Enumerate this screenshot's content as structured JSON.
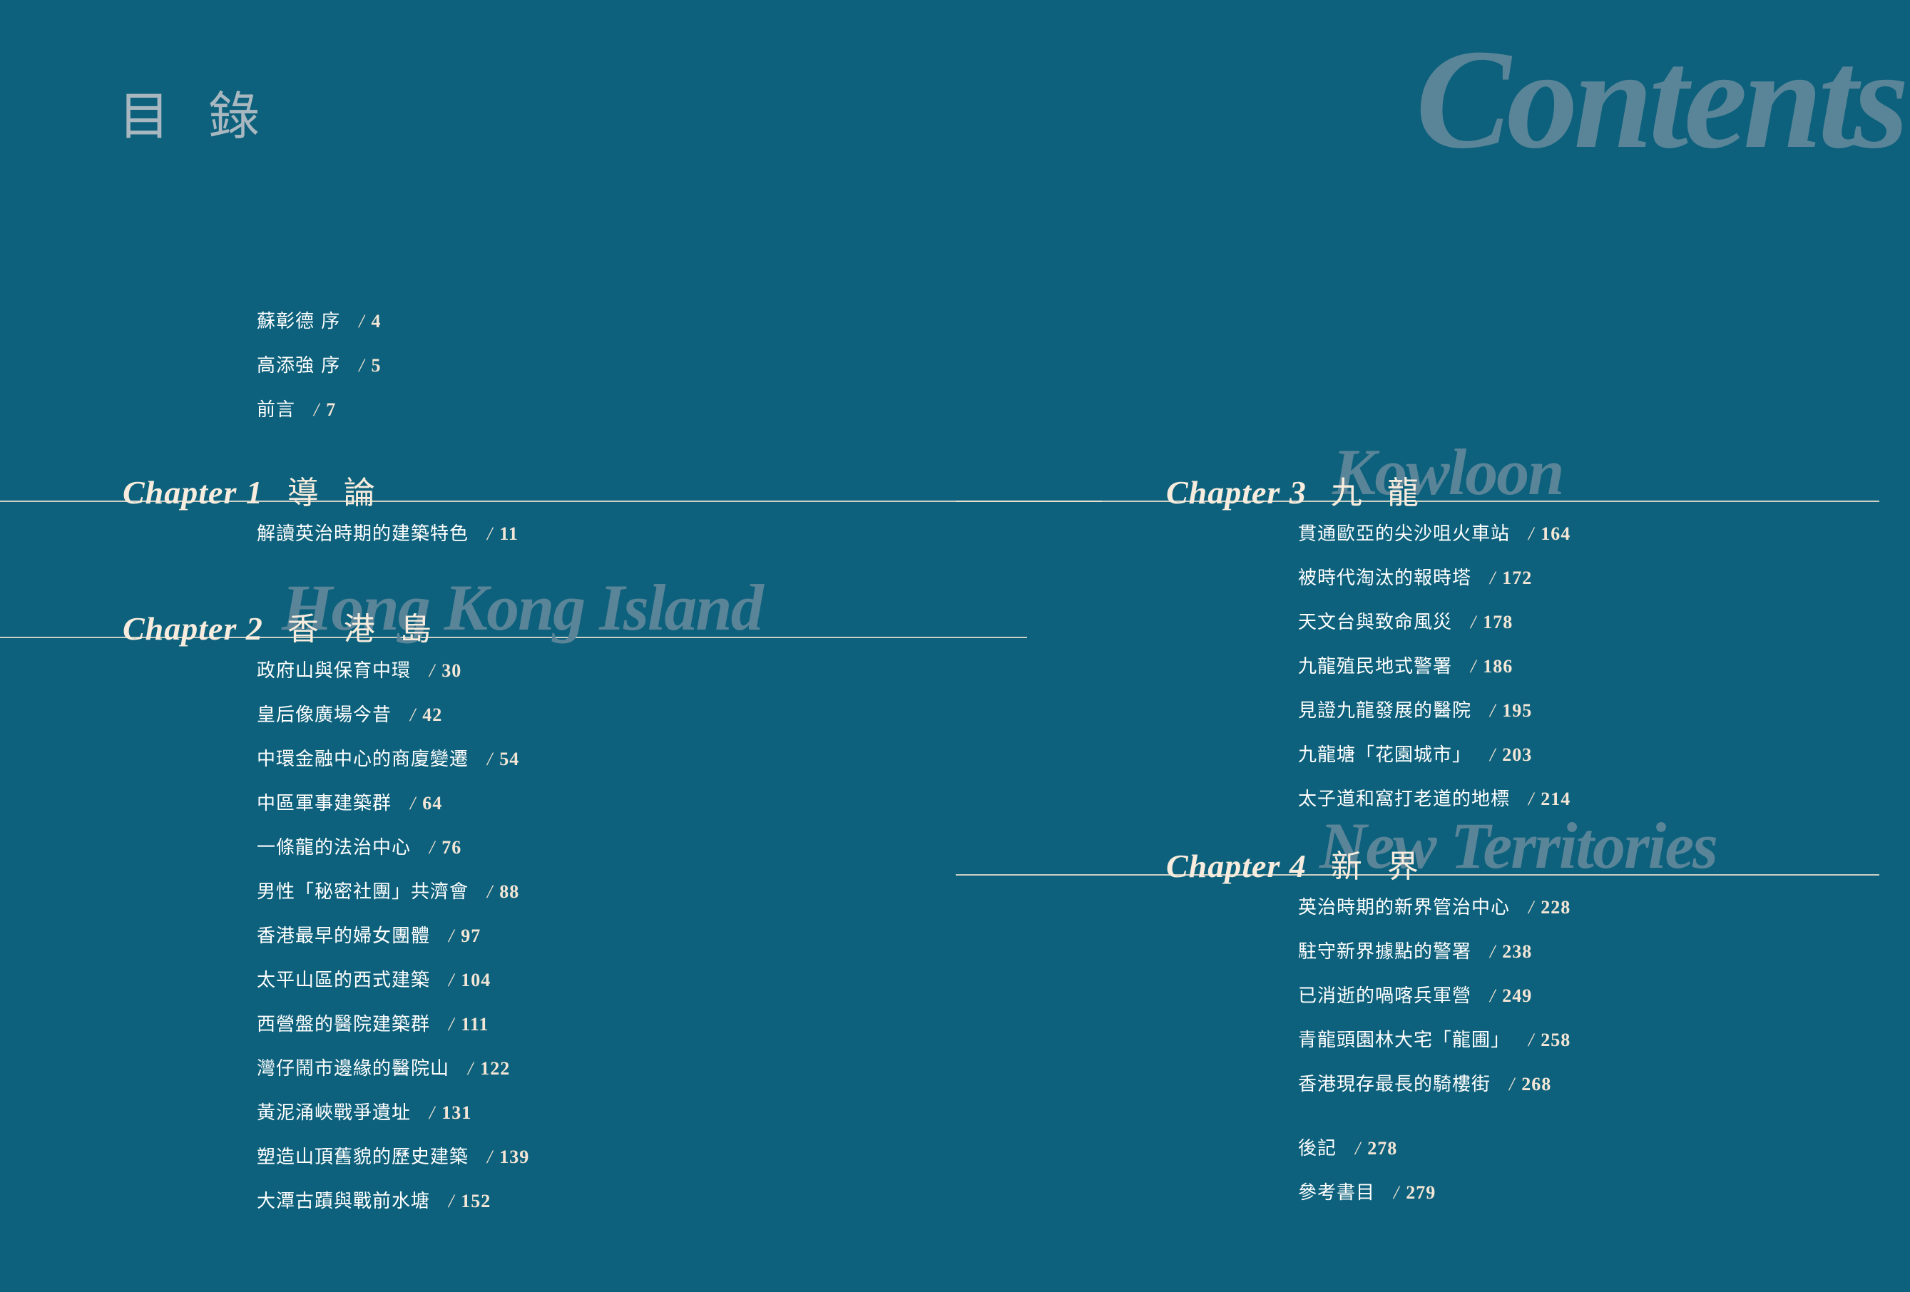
{
  "masthead": {
    "title_cn": "目 錄",
    "title_en": "Contents"
  },
  "colors": {
    "background": "#0d617c",
    "cream": "#f4e6d6",
    "white": "#ffffff",
    "watermark": "#5a8599",
    "masthead_cn": "#a9b8c0"
  },
  "separator": "/",
  "frontmatter": [
    {
      "title": "蘇彰德 序",
      "page": "4"
    },
    {
      "title": "高添強 序",
      "page": "5"
    },
    {
      "title": "前言",
      "page": "7"
    }
  ],
  "chapters": [
    {
      "number": "Chapter 1",
      "title_cn": "導 論",
      "watermark": "",
      "entries": [
        {
          "title": "解讀英治時期的建築特色",
          "page": "11"
        }
      ]
    },
    {
      "number": "Chapter 2",
      "title_cn": "香 港 島",
      "watermark": "Hong Kong Island",
      "entries": [
        {
          "title": "政府山與保育中環",
          "page": "30"
        },
        {
          "title": "皇后像廣場今昔",
          "page": "42"
        },
        {
          "title": "中環金融中心的商廈變遷",
          "page": "54"
        },
        {
          "title": "中區軍事建築群",
          "page": "64"
        },
        {
          "title": "一條龍的法治中心",
          "page": "76"
        },
        {
          "title": "男性「秘密社團」共濟會",
          "page": "88"
        },
        {
          "title": "香港最早的婦女團體",
          "page": "97"
        },
        {
          "title": "太平山區的西式建築",
          "page": "104"
        },
        {
          "title": "西營盤的醫院建築群",
          "page": "111"
        },
        {
          "title": "灣仔鬧市邊緣的醫院山",
          "page": "122"
        },
        {
          "title": "黃泥涌峽戰爭遺址",
          "page": "131"
        },
        {
          "title": "塑造山頂舊貌的歷史建築",
          "page": "139"
        },
        {
          "title": "大潭古蹟與戰前水塘",
          "page": "152"
        }
      ]
    },
    {
      "number": "Chapter 3",
      "title_cn": "九 龍",
      "watermark": "Kowloon",
      "entries": [
        {
          "title": "貫通歐亞的尖沙咀火車站",
          "page": "164"
        },
        {
          "title": "被時代淘汰的報時塔",
          "page": "172"
        },
        {
          "title": "天文台與致命風災",
          "page": "178"
        },
        {
          "title": "九龍殖民地式警署",
          "page": "186"
        },
        {
          "title": "見證九龍發展的醫院",
          "page": "195"
        },
        {
          "title": "九龍塘「花園城市」",
          "page": "203"
        },
        {
          "title": "太子道和窩打老道的地標",
          "page": "214"
        }
      ]
    },
    {
      "number": "Chapter 4",
      "title_cn": "新 界",
      "watermark": "New Territories",
      "entries": [
        {
          "title": "英治時期的新界管治中心",
          "page": "228"
        },
        {
          "title": "駐守新界據點的警署",
          "page": "238"
        },
        {
          "title": "已消逝的喎喀兵軍營",
          "page": "249"
        },
        {
          "title": "青龍頭園林大宅「龍圃」",
          "page": "258"
        },
        {
          "title": "香港現存最長的騎樓街",
          "page": "268"
        }
      ]
    }
  ],
  "backmatter": [
    {
      "title": "後記",
      "page": "278"
    },
    {
      "title": "參考書目",
      "page": "279"
    }
  ]
}
